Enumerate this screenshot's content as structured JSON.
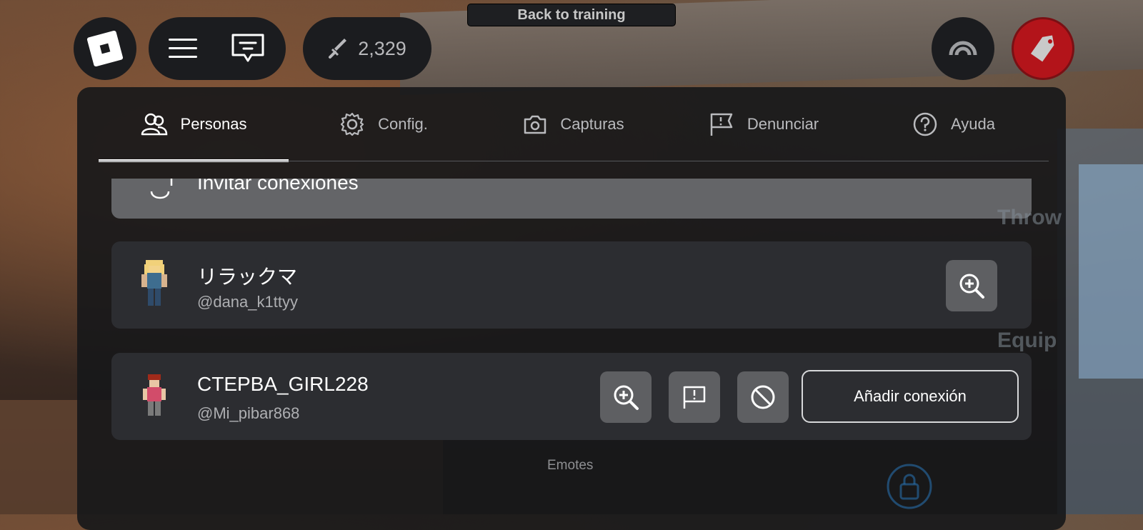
{
  "top_bar": {
    "points_value": "2,329",
    "back_to_training_label": "Back to training"
  },
  "menu": {
    "tabs": [
      {
        "label": "Personas",
        "icon": "people-icon",
        "active": true
      },
      {
        "label": "Config.",
        "icon": "gear-icon",
        "active": false
      },
      {
        "label": "Capturas",
        "icon": "camera-icon",
        "active": false
      },
      {
        "label": "Denunciar",
        "icon": "report-flag-icon",
        "active": false
      },
      {
        "label": "Ayuda",
        "icon": "help-icon",
        "active": false
      }
    ],
    "invite_label": "Invitar conexiones",
    "players": [
      {
        "display_name": "リラックマ",
        "username": "@dana_k1ttyy"
      },
      {
        "display_name": "CTEPBA_GIRL228",
        "username": "@Mi_pibar868",
        "add_connection_label": "Añadir conexión"
      }
    ]
  },
  "game_hud": {
    "throw_label": "Throw",
    "equip_label": "Equip",
    "emotes_label": "Emotes"
  },
  "colors": {
    "panel_bg": "#16171a",
    "row_bg": "#2c2d31",
    "invite_bg": "#646568",
    "shop_button": "#b3141a",
    "icon_button": "#5e5f62"
  }
}
